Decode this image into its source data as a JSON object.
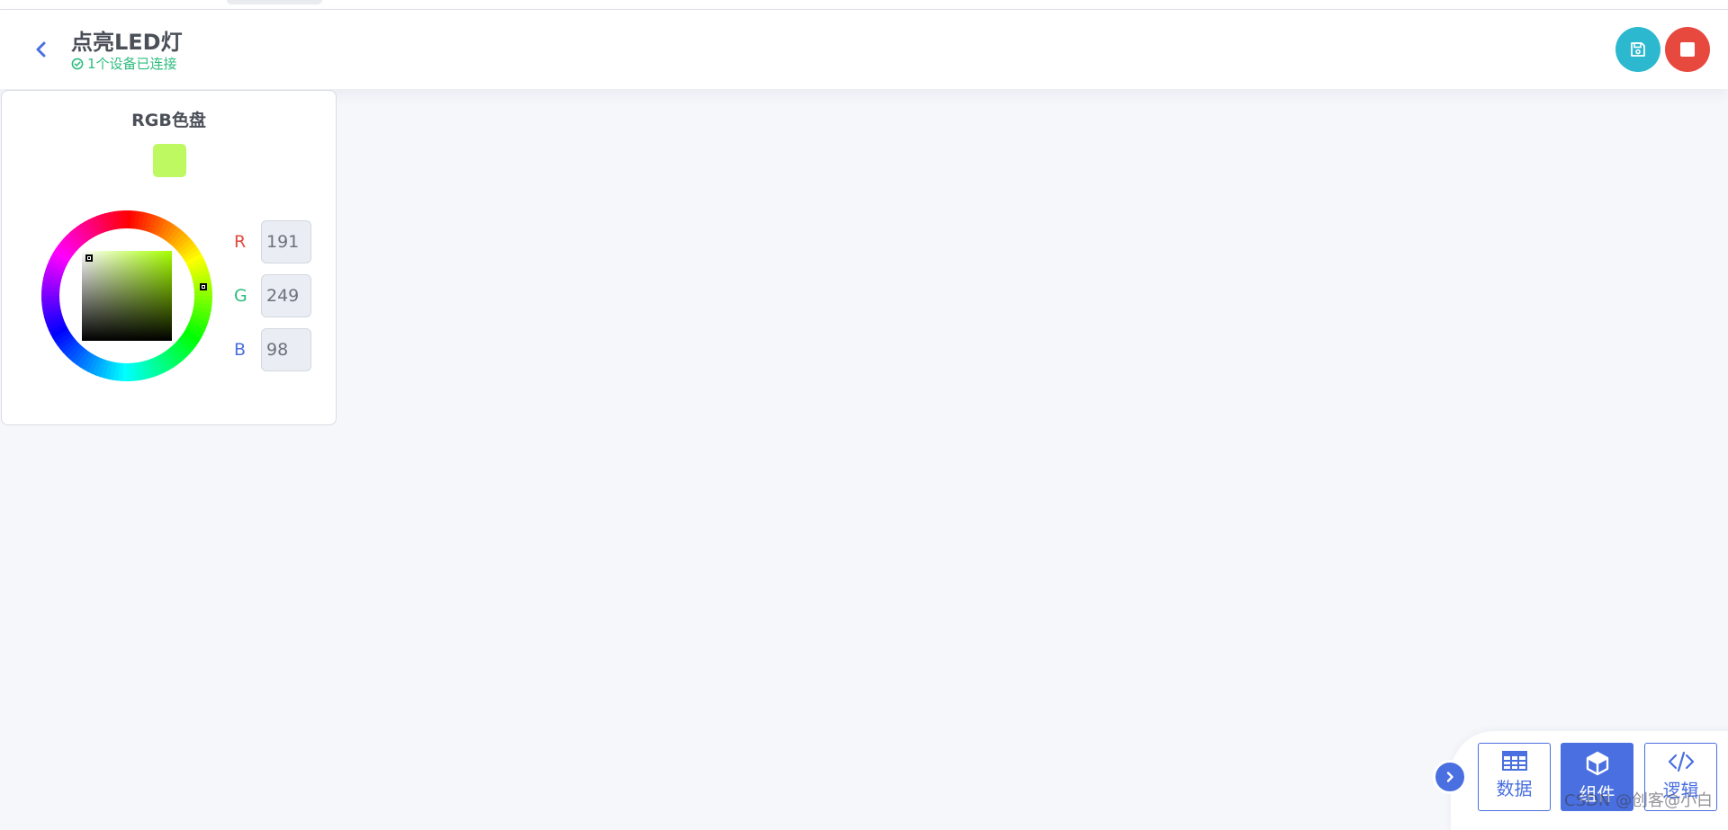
{
  "header": {
    "title": "点亮LED灯",
    "status": "1个设备已连接"
  },
  "widget": {
    "title": "RGB色盘",
    "color_hex": "#bff962",
    "r_label": "R",
    "g_label": "G",
    "b_label": "B",
    "r_value": "191",
    "g_value": "249",
    "b_value": "98",
    "r_color": "#e04a3c",
    "g_color": "#2ebd7f",
    "b_color": "#4a6fe0"
  },
  "dock": {
    "data_label": "数据",
    "component_label": "组件",
    "logic_label": "逻辑"
  },
  "watermark": "CSDN @创客@小白",
  "colors": {
    "accent": "#4a6fe0",
    "save": "#2cb9cf",
    "stop": "#e8493f",
    "success": "#2ebd7f"
  }
}
